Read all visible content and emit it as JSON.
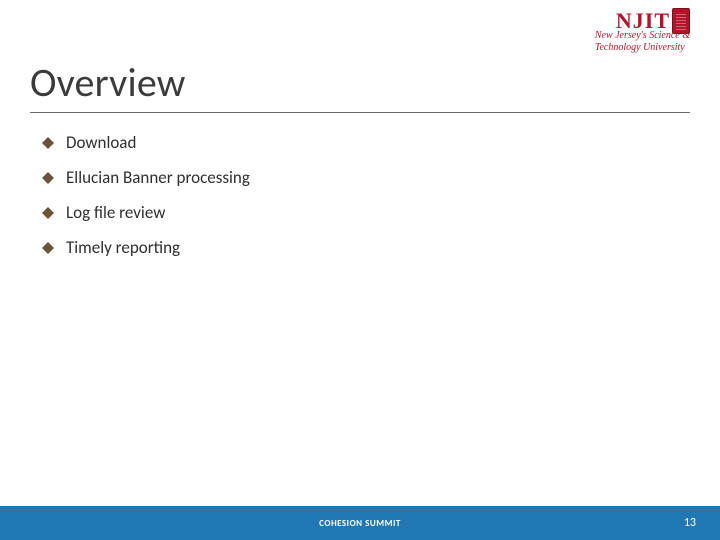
{
  "logo": {
    "letters": "NJIT",
    "tagline_line1": "New Jersey's Science &",
    "tagline_line2": "Technology University"
  },
  "title": "Overview",
  "bullets": [
    {
      "text": "Download"
    },
    {
      "text": "Ellucian Banner processing"
    },
    {
      "text": "Log file review"
    },
    {
      "text": "Timely reporting"
    }
  ],
  "footer": {
    "center": "COHESION SUMMIT",
    "page": "13"
  }
}
